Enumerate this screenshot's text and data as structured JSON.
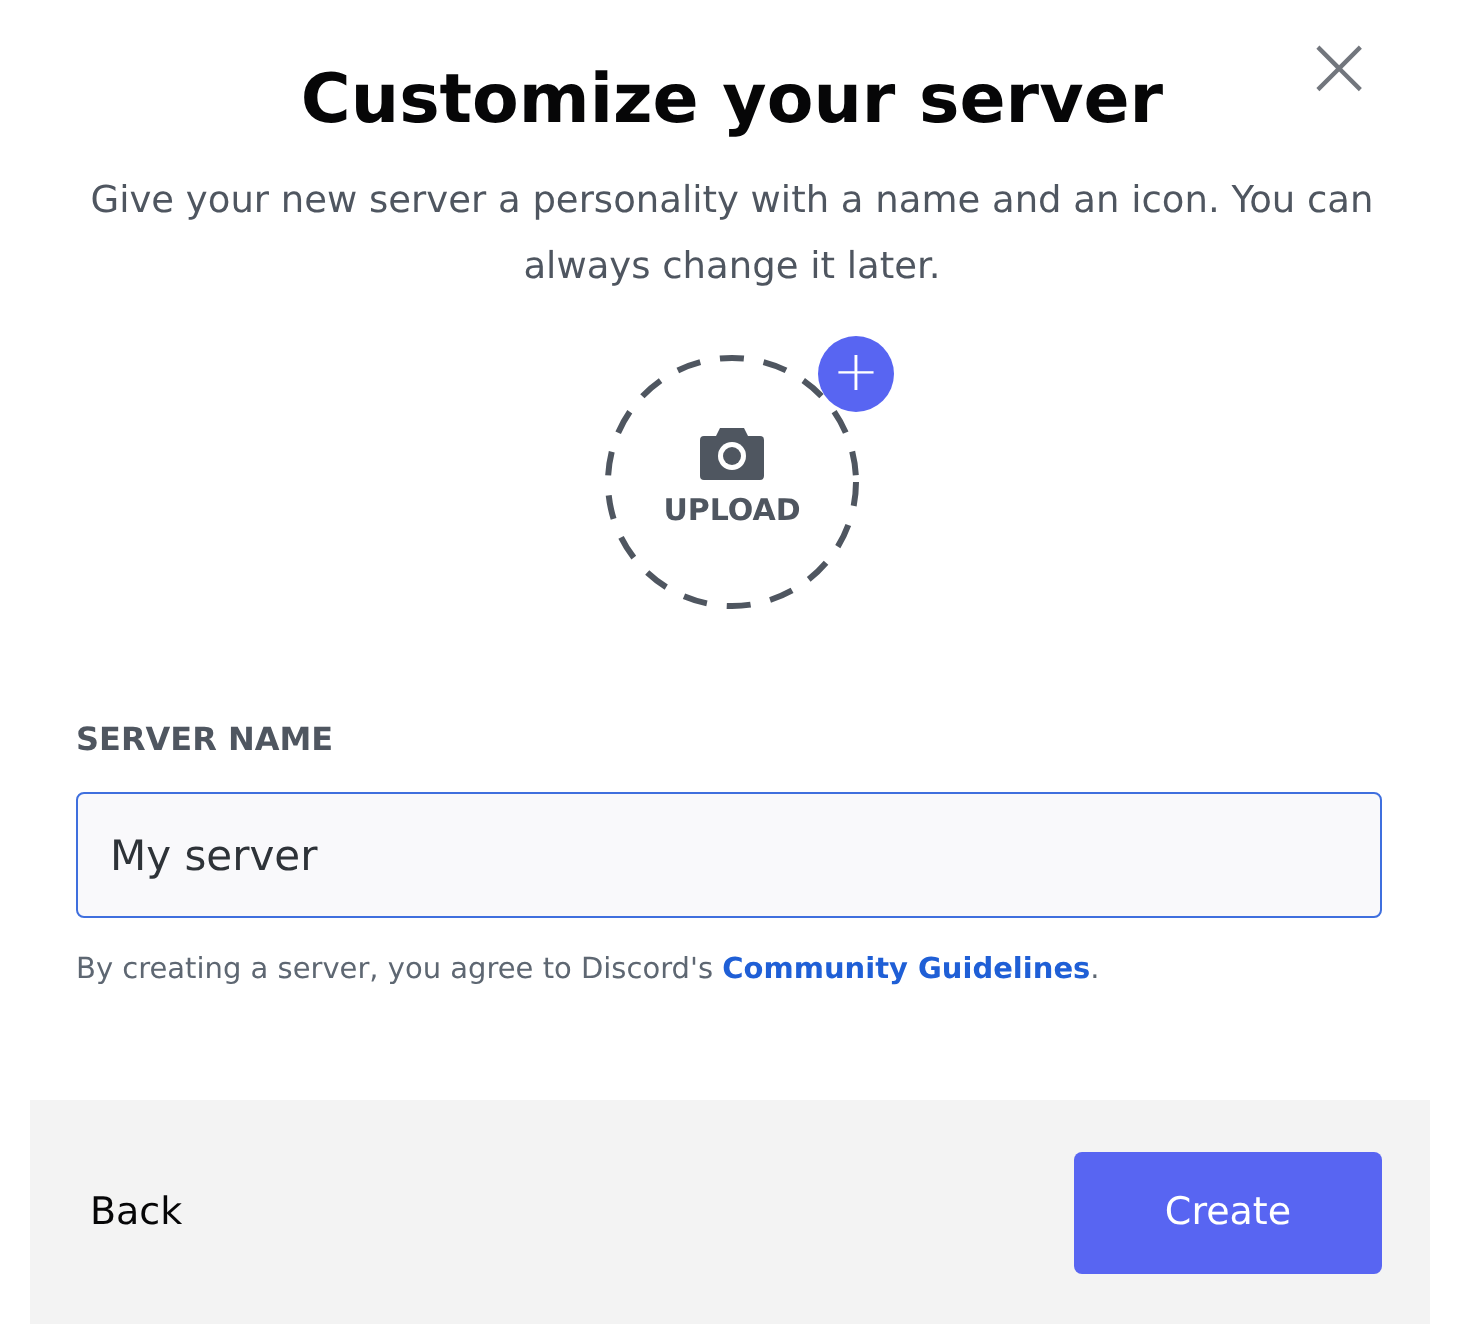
{
  "dialog": {
    "title": "Customize your server",
    "subtitle": "Give your new server a personality with a name and an icon. You can always change it later.",
    "close": "×"
  },
  "upload": {
    "label": "UPLOAD",
    "badge": "+"
  },
  "server_name": {
    "label": "SERVER NAME",
    "value": "My server",
    "focused": true
  },
  "note": {
    "before": "By creating a server, you agree to Discord's ",
    "link": "Community Guidelines",
    "after": "."
  },
  "footer": {
    "back": "Back",
    "create": "Create"
  }
}
